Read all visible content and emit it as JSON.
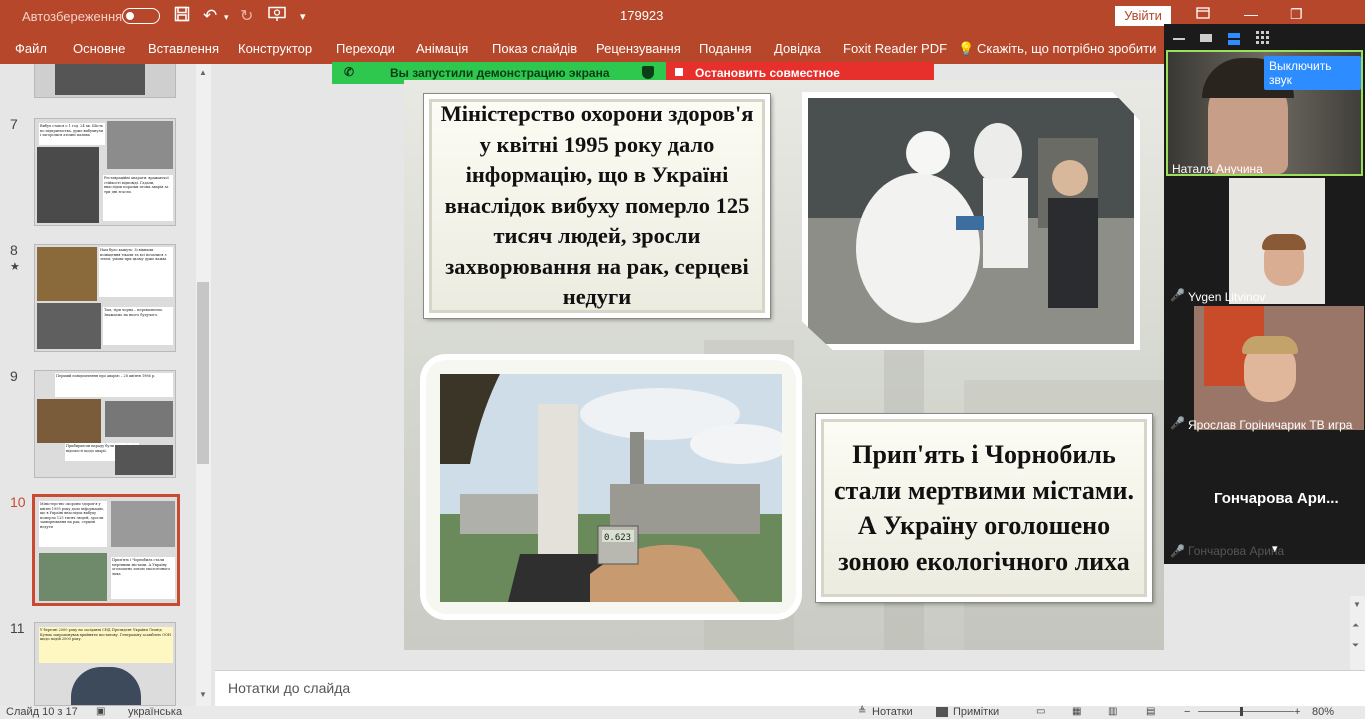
{
  "titlebar": {
    "autosave_label": "Автозбереження",
    "document_title": "179923",
    "signin_label": "Увійти"
  },
  "ribbon_tabs": [
    "Файл",
    "Основне",
    "Вставлення",
    "Конструктор",
    "Переходи",
    "Анімація",
    "Показ слайдів",
    "Рецензування",
    "Подання",
    "Довідка",
    "Foxit Reader PDF",
    "Що, потрібно зробити"
  ],
  "ribbon_tellme": "Скажіть, що потрібно зробити",
  "share_banner": {
    "sharing_text": "Вы запустили демонстрацию экрана",
    "stop_text": "Остановить совместное использование"
  },
  "thumbnails": {
    "numbers": [
      "7",
      "8",
      "9",
      "10",
      "11"
    ],
    "selected": "10",
    "t7_text": "Вибух стався о 1 год. 24 хв. Шість по підприємства, дуже вибухнули і загорілися атомні палива",
    "t7_text2": "Реставраційні апарати: вражаючої стійкості відповіді. Гадали, внаслідок поразки атома аварія за три дні згасли.",
    "t8_text": "Нам було кажуть: Зі вікнами поміщення тікали та всі почалися з землі: умови при цьому дуже важкі.",
    "t8_text2": "Там, тіри чорна – перевалюємо. Зважаємо на нього будучого.",
    "t9_text": "Перший повідомлення про аварію – 28 квітня 1986 р.",
    "t9_text2": "Прибираючи нараду були допоміжні відомості щодо аварії.",
    "t10_text": "Міністерство охорони здоров'я у квітні 1995 року дало інформацію, що в Україні внаслідок вибуху померло 125 тисяч людей, зросли захворювання на рак, серцеві недуги",
    "t10_text2": "Прип'ять і Чорнобиль стали мертвими містами. А Україну оголошено зоною екологічного лиха",
    "t11_text": "У березні 2000 року на засіданні СНД Президент України Леонід Кучма запропонував прийняти постанову. Генеральну асамблею ООН щодо подій 2000 року."
  },
  "slide": {
    "text_top": "Міністерство охорони здоров'я у квітні 1995 року дало інформацію, що в Україні внаслідок вибуху померло 125 тисяч людей, зросли захворювання на рак, серцеві недуги",
    "text_bottom": "Прип'ять і Чорнобиль стали мертвими містами. А Україну оголошено зоною екологічного лиха",
    "dosimeter_reading": "0.623"
  },
  "notes_placeholder": "Нотатки до слайда",
  "statusbar": {
    "slide_counter": "Слайд 10 з 17",
    "language": "українська",
    "notes_label": "Нотатки",
    "comments_label": "Примітки",
    "zoom_value": "80%"
  },
  "zoom_panel": {
    "mute_button": "Выключить звук",
    "participants": [
      {
        "name": "Наталя Анучина",
        "muted": false
      },
      {
        "name": "Yvgen Litvinov",
        "muted": true
      },
      {
        "name": "Ярослав Горіничарик ТВ игра",
        "muted": true
      },
      {
        "name": "Гончарова Арина",
        "muted": true
      }
    ],
    "tile_name_large": "Гончарова Ари..."
  },
  "colors": {
    "accent": "#b7472a",
    "share_green": "#2fc84f",
    "share_red": "#e7302b",
    "selected_border": "#c84b31"
  }
}
